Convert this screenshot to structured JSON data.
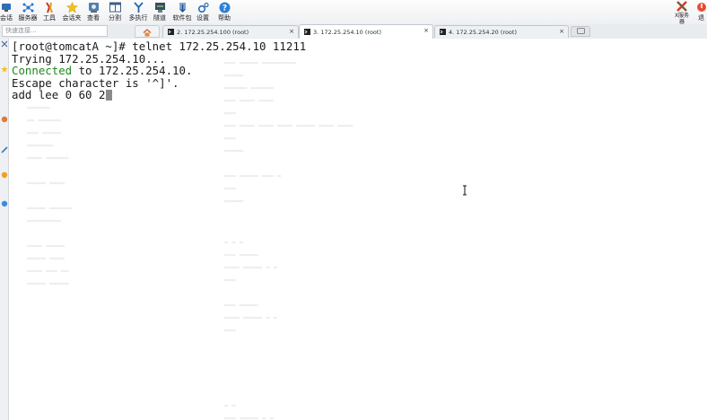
{
  "toolbar": {
    "buttons": [
      {
        "label": "会话",
        "icon": "session-icon"
      },
      {
        "label": "服务器",
        "icon": "server-icon"
      },
      {
        "label": "工具",
        "icon": "tools-icon"
      },
      {
        "label": "会话夹",
        "icon": "star-icon"
      },
      {
        "label": "查看",
        "icon": "view-icon"
      },
      {
        "label": "分割",
        "icon": "split-icon"
      },
      {
        "label": "多执行",
        "icon": "multi-exec-icon"
      },
      {
        "label": "隧道",
        "icon": "tunnel-icon"
      },
      {
        "label": "软件包",
        "icon": "package-icon"
      },
      {
        "label": "设置",
        "icon": "settings-icon"
      },
      {
        "label": "帮助",
        "icon": "help-icon"
      }
    ],
    "right_label": "X服务器",
    "right_small": "退"
  },
  "quick_connect": {
    "placeholder": "快速连接..."
  },
  "tabs": [
    {
      "label": "2. 172.25.254.100 (root)",
      "active": false
    },
    {
      "label": "3. 172.25.254.10 (root)",
      "active": true
    },
    {
      "label": "4. 172.25.254.20 (root)",
      "active": false
    }
  ],
  "terminal": {
    "lines": [
      {
        "prompt": "[root@tomcatA ~]# ",
        "command": "telnet 172.25.254.10 11211"
      },
      {
        "text": "Trying 172.25.254.10..."
      },
      {
        "green": "Connected",
        "rest": " to 172.25.254.10."
      },
      {
        "text": "Escape character is '^]'."
      },
      {
        "text": "add lee 0 60 2"
      }
    ]
  },
  "colors": {
    "terminal_bg": "#ffffff",
    "terminal_fg": "#1b1b1b",
    "connected_green": "#1e8a1e",
    "tab_active": "#ffffff",
    "toolbar_bg": "#eef0f3"
  }
}
